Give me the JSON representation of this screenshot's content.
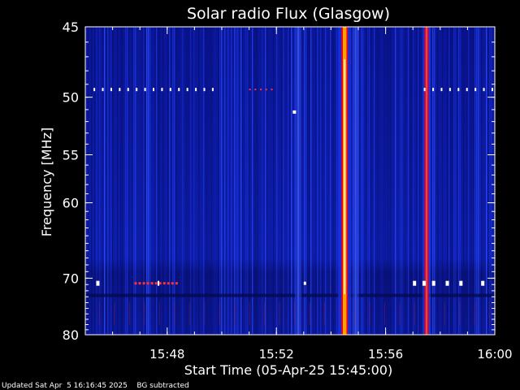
{
  "chart_data": {
    "type": "heatmap",
    "title": "Solar radio Flux (Glasgow)",
    "xlabel": "Start Time (05-Apr-25 15:45:00)",
    "ylabel": "Frequency [MHz]",
    "x_unit": "minutes after 15:45:00",
    "xlim": [
      0,
      15
    ],
    "ylim": [
      45,
      80
    ],
    "y_scale": "reciprocal",
    "x_ticks": [
      {
        "value": 3,
        "label": "15:48"
      },
      {
        "value": 7,
        "label": "15:52"
      },
      {
        "value": 11,
        "label": "15:56"
      },
      {
        "value": 15,
        "label": "16:00"
      }
    ],
    "y_ticks": [
      {
        "value": 45,
        "label": "45"
      },
      {
        "value": 50,
        "label": "50"
      },
      {
        "value": 55,
        "label": "55"
      },
      {
        "value": 60,
        "label": "60"
      },
      {
        "value": 70,
        "label": "70"
      },
      {
        "value": 80,
        "label": "80"
      }
    ],
    "bursts": [
      {
        "time": 9.5,
        "intensity": "high"
      },
      {
        "time": 12.5,
        "intensity": "medium"
      },
      {
        "time": 7.8,
        "intensity": "low"
      },
      {
        "time": 9.9,
        "intensity": "low"
      }
    ],
    "colormap": [
      "#000080",
      "#1030ff",
      "#ff0000",
      "#ffa000",
      "#ffffff"
    ]
  },
  "footer": {
    "updated": "Updated Sat Apr  5 16:16:45 2025",
    "note": "BG subtracted"
  }
}
